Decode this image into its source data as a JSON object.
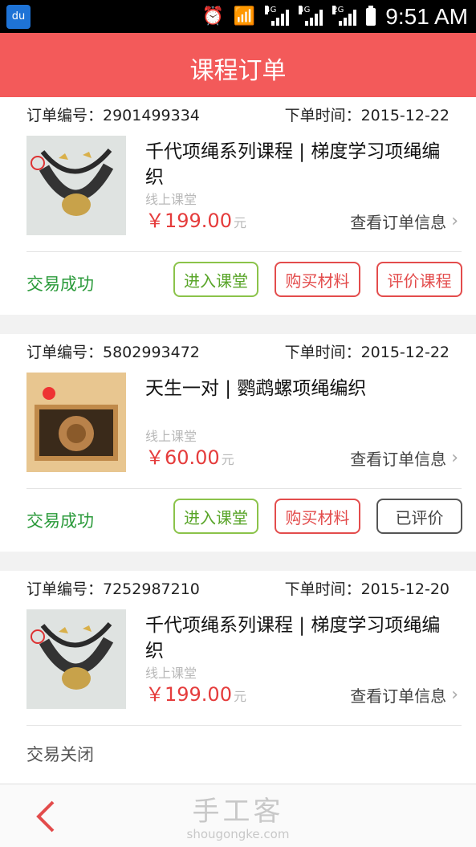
{
  "status_bar": {
    "time": "9:51 AM",
    "network_1": "4G",
    "network_2": "4G",
    "network_3": "2G"
  },
  "header": {
    "title": "课程订单"
  },
  "orders": [
    {
      "order_no": "订单编号：2901499334",
      "order_time": "下单时间：2015-12-22",
      "product_name": "千代项绳系列课程 | 梯度学习项绳编织",
      "type": "线上课堂",
      "price": "￥199.00",
      "unit": "元",
      "view_label": "查看订单信息",
      "status": "交易成功",
      "buttons": [
        "进入课堂",
        "购买材料",
        "评价课程"
      ]
    },
    {
      "order_no": "订单编号：5802993472",
      "order_time": "下单时间：2015-12-22",
      "product_name": "天生一对 | 鹦鹉螺项绳编织",
      "type": "线上课堂",
      "price": "￥60.00",
      "unit": "元",
      "view_label": "查看订单信息",
      "status": "交易成功",
      "buttons": [
        "进入课堂",
        "购买材料",
        "已评价"
      ]
    },
    {
      "order_no": "订单编号：7252987210",
      "order_time": "下单时间：2015-12-20",
      "product_name": "千代项绳系列课程 | 梯度学习项绳编织",
      "type": "线上课堂",
      "price": "￥199.00",
      "unit": "元",
      "view_label": "查看订单信息",
      "status": "交易关闭",
      "buttons": []
    }
  ],
  "footer": {
    "logo_cn": "手工客",
    "logo_en": "shougongke.com",
    "back_icon": "chevron-left-icon"
  },
  "colors": {
    "header": "#f35a5a",
    "success": "#2a9a3a",
    "price": "#e53c3c"
  }
}
